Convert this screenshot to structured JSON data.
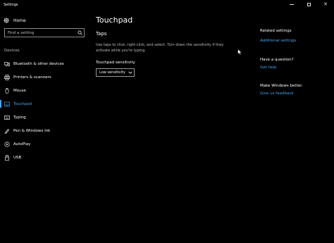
{
  "window": {
    "title": "Settings",
    "controls": {
      "minimize": "minimize-icon",
      "maximize": "maximize-icon",
      "close": "close-icon"
    }
  },
  "sidebar": {
    "home_label": "Home",
    "search_placeholder": "Find a setting",
    "section_label": "Devices",
    "items": [
      {
        "label": "Bluetooth & other devices",
        "icon": "bluetooth-devices-icon"
      },
      {
        "label": "Printers & scanners",
        "icon": "printer-icon"
      },
      {
        "label": "Mouse",
        "icon": "mouse-icon"
      },
      {
        "label": "Touchpad",
        "icon": "touchpad-icon",
        "active": true
      },
      {
        "label": "Typing",
        "icon": "keyboard-icon"
      },
      {
        "label": "Pen & Windows Ink",
        "icon": "pen-icon"
      },
      {
        "label": "AutoPlay",
        "icon": "autoplay-icon"
      },
      {
        "label": "USB",
        "icon": "usb-icon"
      }
    ]
  },
  "main": {
    "page_title": "Touchpad",
    "section_title": "Taps",
    "description": "Use taps to click, right-click, and select. Turn down the sensitivity if they activate while you're typing",
    "sensitivity_label": "Touchpad sensitivity",
    "sensitivity_value": "Low sensitivity"
  },
  "right": {
    "related_heading": "Related settings",
    "related_link": "Additional settings",
    "question_heading": "Have a question?",
    "help_link": "Get help",
    "better_heading": "Make Windows better.",
    "feedback_link": "Give us feedback"
  },
  "colors": {
    "accent": "#4aa3e6",
    "background": "#000000"
  }
}
